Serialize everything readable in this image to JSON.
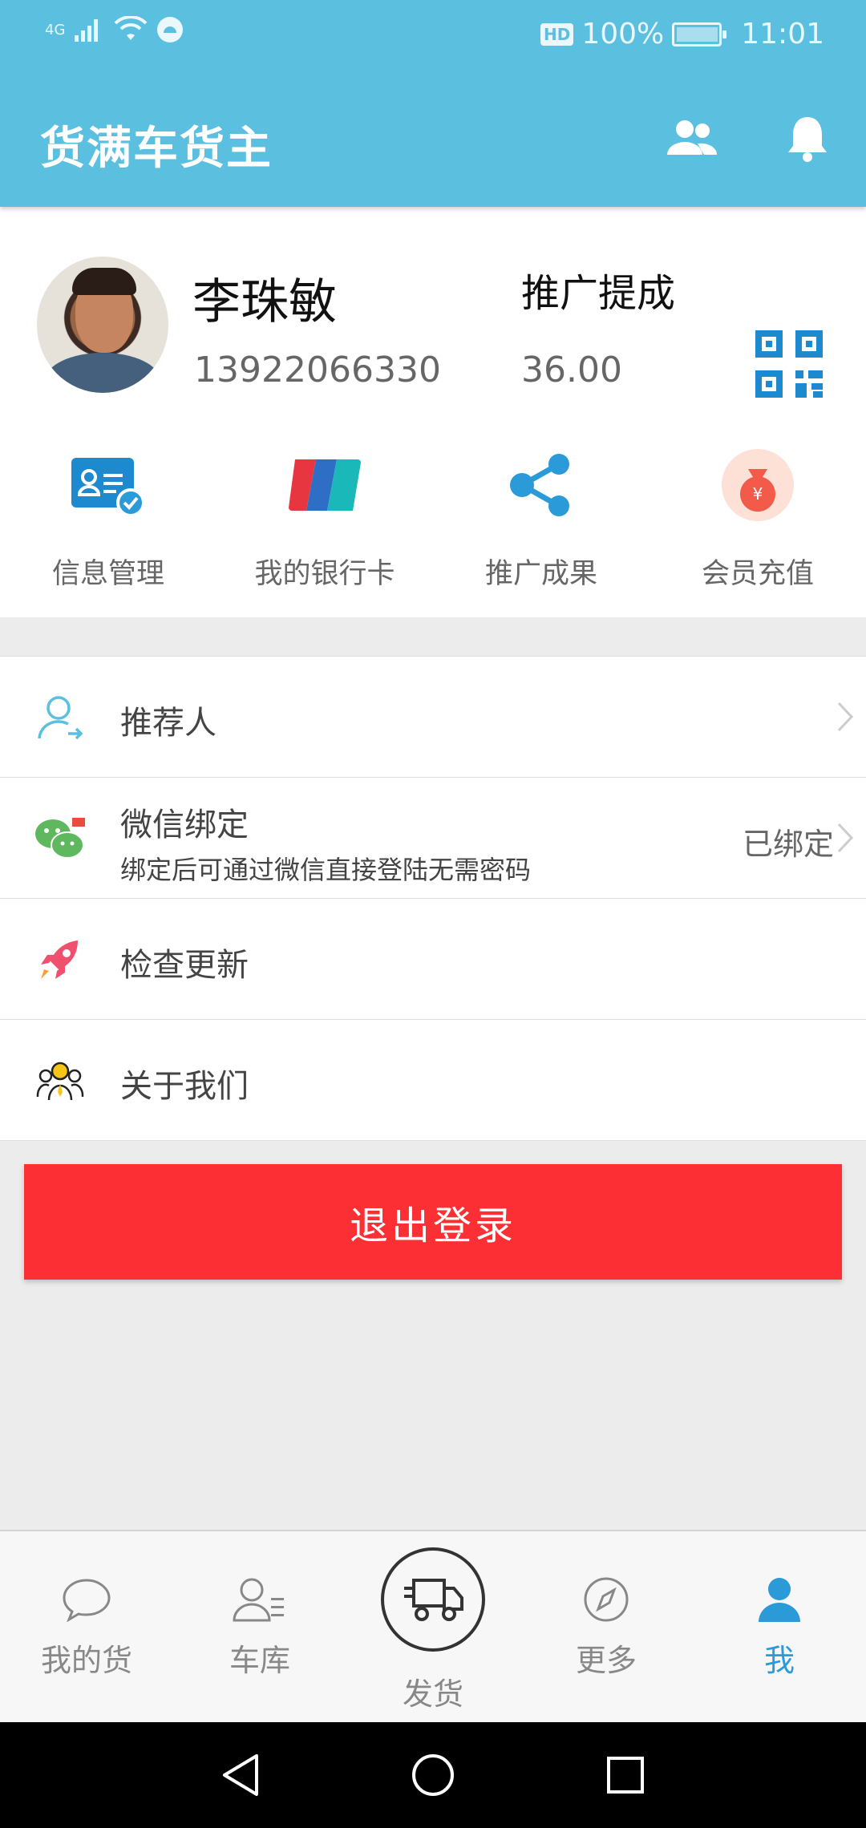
{
  "status_bar": {
    "network": "4G",
    "hd": "HD",
    "battery": "100%",
    "time": "11:01"
  },
  "app": {
    "title": "货满车货主"
  },
  "profile": {
    "name": "李珠敏",
    "phone": "13922066330",
    "promo_label": "推广提成",
    "promo_value": "36.00"
  },
  "quick_actions": [
    {
      "label": "信息管理",
      "icon": "id-card-icon"
    },
    {
      "label": "我的银行卡",
      "icon": "bank-card-icon"
    },
    {
      "label": "推广成果",
      "icon": "share-icon"
    },
    {
      "label": "会员充值",
      "icon": "money-bag-icon"
    }
  ],
  "menu": {
    "referrer": "推荐人",
    "wechat_title": "微信绑定",
    "wechat_sub": "绑定后可通过微信直接登陆无需密码",
    "wechat_status": "已绑定",
    "check_update": "检查更新",
    "about": "关于我们"
  },
  "logout_label": "退出登录",
  "bottom_nav": {
    "my_goods": "我的货",
    "garage": "车库",
    "ship": "发货",
    "more": "更多",
    "me": "我"
  },
  "colors": {
    "header": "#5bbfdf",
    "logout": "#fc3034",
    "active_tab": "#2b9ad8"
  }
}
